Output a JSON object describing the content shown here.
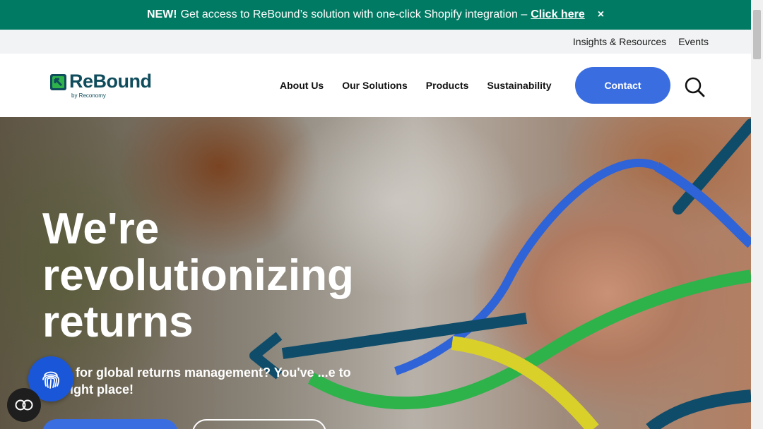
{
  "announcement": {
    "new_label": "NEW!",
    "message": "Get access to ReBound’s solution with one-click Shopify integration –",
    "link_label": "Click here",
    "close_icon": "×"
  },
  "utility_nav": {
    "items": [
      {
        "label": "Insights & Resources"
      },
      {
        "label": "Events"
      }
    ]
  },
  "header": {
    "logo_text": "ReBound",
    "logo_sub": "by Reconomy",
    "nav": [
      {
        "label": "About Us"
      },
      {
        "label": "Our Solutions"
      },
      {
        "label": "Products"
      },
      {
        "label": "Sustainability"
      }
    ],
    "contact_label": "Contact",
    "search_icon": "search-icon"
  },
  "hero": {
    "title_lines": [
      "We're",
      "revolutionizing",
      "returns"
    ],
    "subtitle": "...ing for global returns management? You've ...e to the right place!"
  },
  "colors": {
    "announce_bg": "#017a63",
    "brand_blue": "#3a6ee0",
    "logo_navy": "#0f4c5c",
    "logo_green": "#2db34a"
  }
}
